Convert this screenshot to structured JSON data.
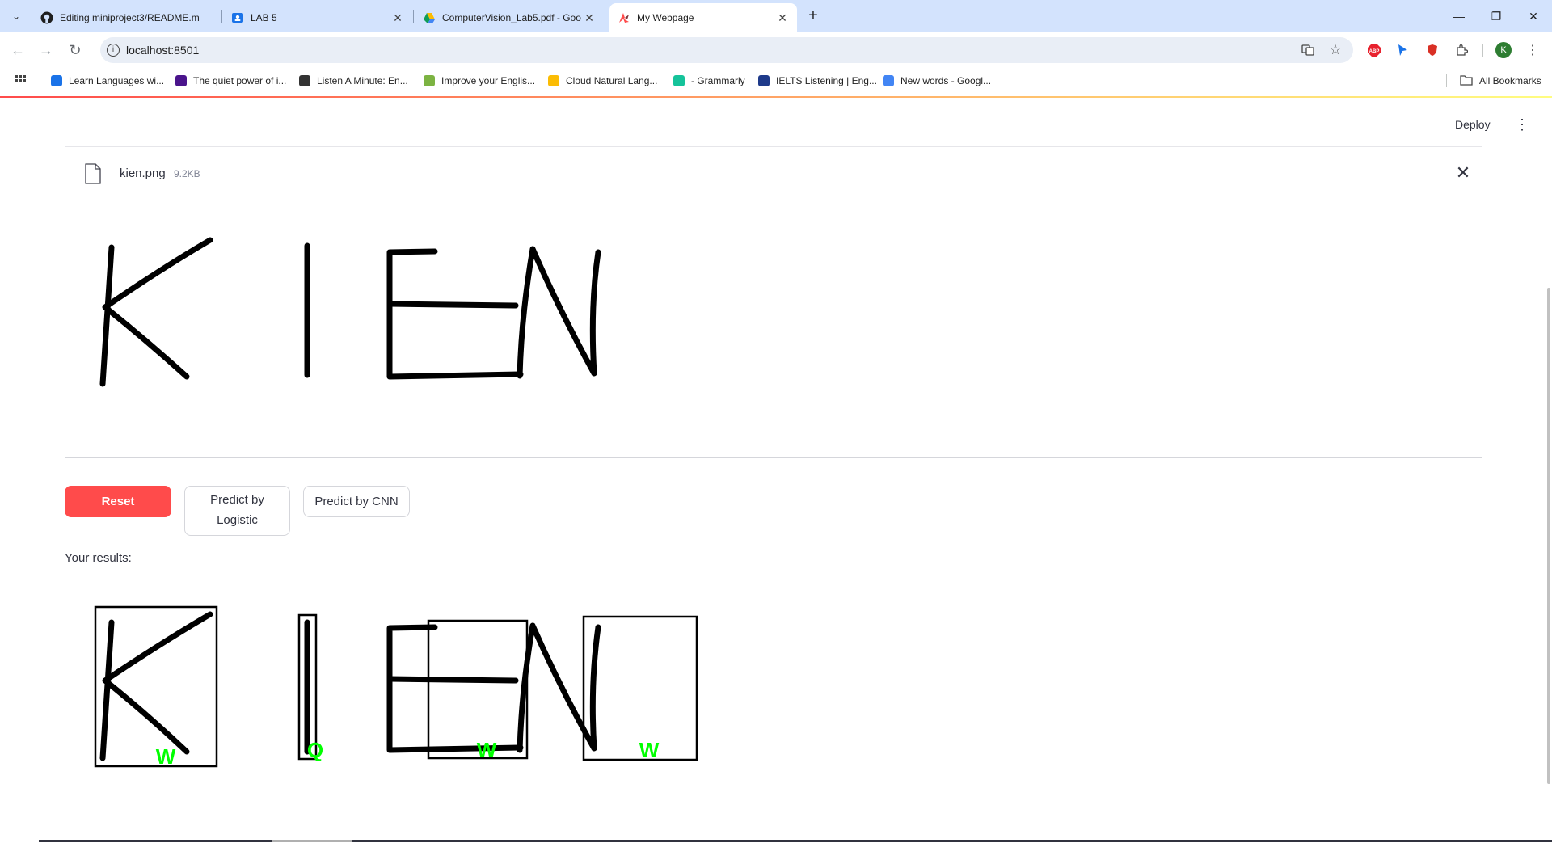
{
  "browser": {
    "tabs": [
      {
        "title": "Editing miniproject3/README.m",
        "icon": "github-icon",
        "active": false
      },
      {
        "title": "LAB 5",
        "icon": "contacts-icon",
        "active": false
      },
      {
        "title": "ComputerVision_Lab5.pdf - Goo",
        "icon": "google-drive-icon",
        "active": false
      },
      {
        "title": "My Webpage",
        "icon": "streamlit-icon",
        "active": true
      }
    ],
    "url": "localhost:8501",
    "bookmarks": [
      {
        "label": "Learn Languages wi...",
        "color": "#1a73e8"
      },
      {
        "label": "The quiet power of i...",
        "color": "#4a148c"
      },
      {
        "label": "Listen A Minute: En...",
        "color": "#333333"
      },
      {
        "label": "Improve your Englis...",
        "color": "#7cb342"
      },
      {
        "label": "Cloud Natural Lang...",
        "color": "#fbbc04"
      },
      {
        "label": "- Grammarly",
        "color": "#15c39a"
      },
      {
        "label": "IELTS Listening | Eng...",
        "color": "#1e3a8a"
      },
      {
        "label": "New words - Googl...",
        "color": "#4285f4"
      }
    ],
    "all_bookmarks": "All Bookmarks",
    "profile_initial": "K"
  },
  "app": {
    "deploy_label": "Deploy",
    "file": {
      "name": "kien.png",
      "size": "9.2KB"
    },
    "buttons": {
      "reset": "Reset",
      "logistic_line1": "Predict by",
      "logistic_line2": "Logistic",
      "cnn": "Predict by CNN"
    },
    "results_label": "Your results:",
    "predictions": [
      "W",
      "Q",
      "W",
      "W"
    ],
    "prediction_color": "#00ff00",
    "accent_color": "#ff4b4b"
  }
}
